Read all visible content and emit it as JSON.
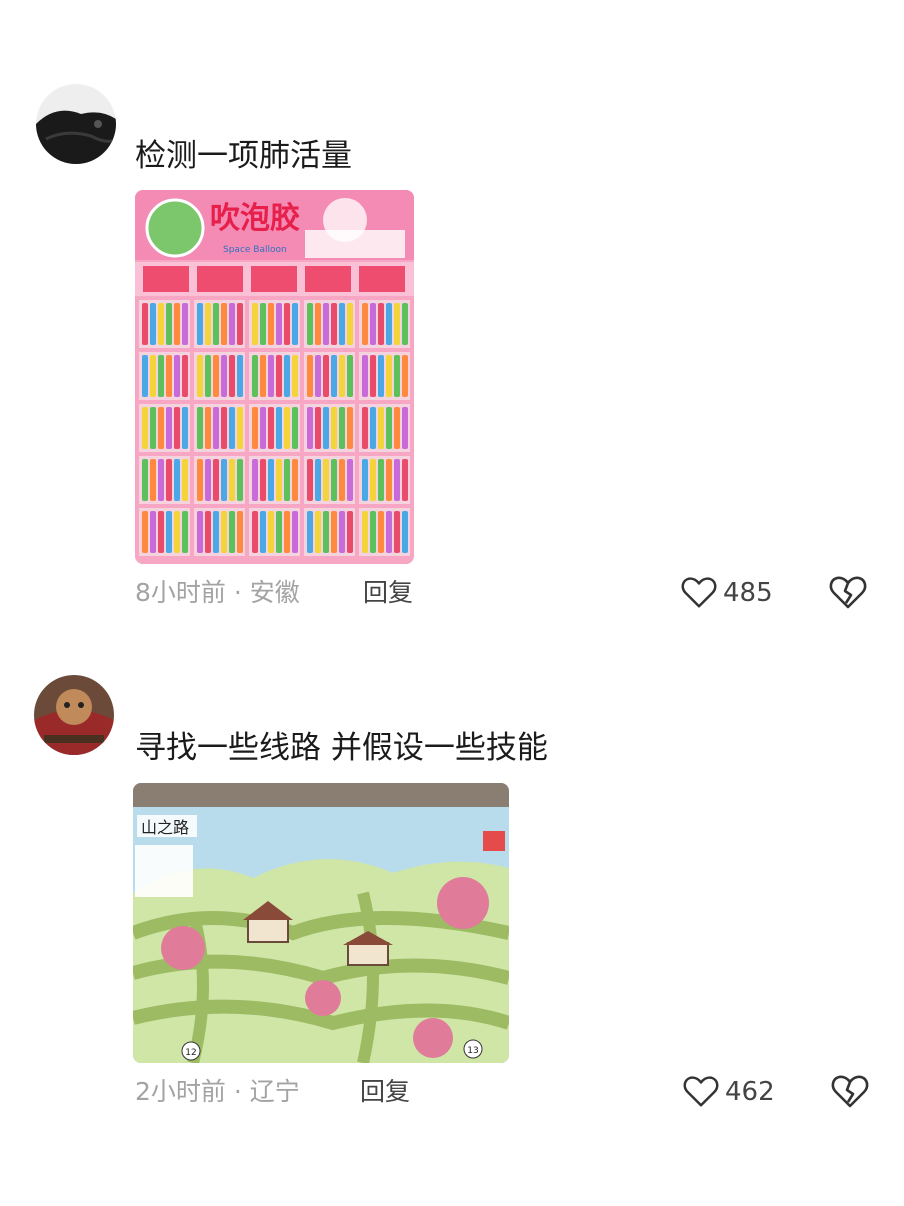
{
  "comments": [
    {
      "text": "检测一项肺活量",
      "time": "8小时前",
      "location": "安徽",
      "meta_sep": "·",
      "reply_label": "回复",
      "likes": "485",
      "image": {
        "package_title": "吹泡胶",
        "package_subtitle": "Space Balloon",
        "tube_colors": [
          "#e94b6a",
          "#4aa8e6",
          "#f3d43a",
          "#5cc15a",
          "#ff8a3d",
          "#c86ad8"
        ],
        "card_color": "#f7a7c3"
      }
    },
    {
      "text": "寻找一些线路 并假设一些技能",
      "time": "2小时前",
      "location": "辽宁",
      "meta_sep": "·",
      "reply_label": "回复",
      "likes": "462",
      "image": {
        "map_title": "山之路",
        "page_left": "12",
        "page_right": "13"
      }
    }
  ],
  "icons": {
    "like": "heart-outline-icon",
    "dislike": "broken-heart-icon"
  }
}
